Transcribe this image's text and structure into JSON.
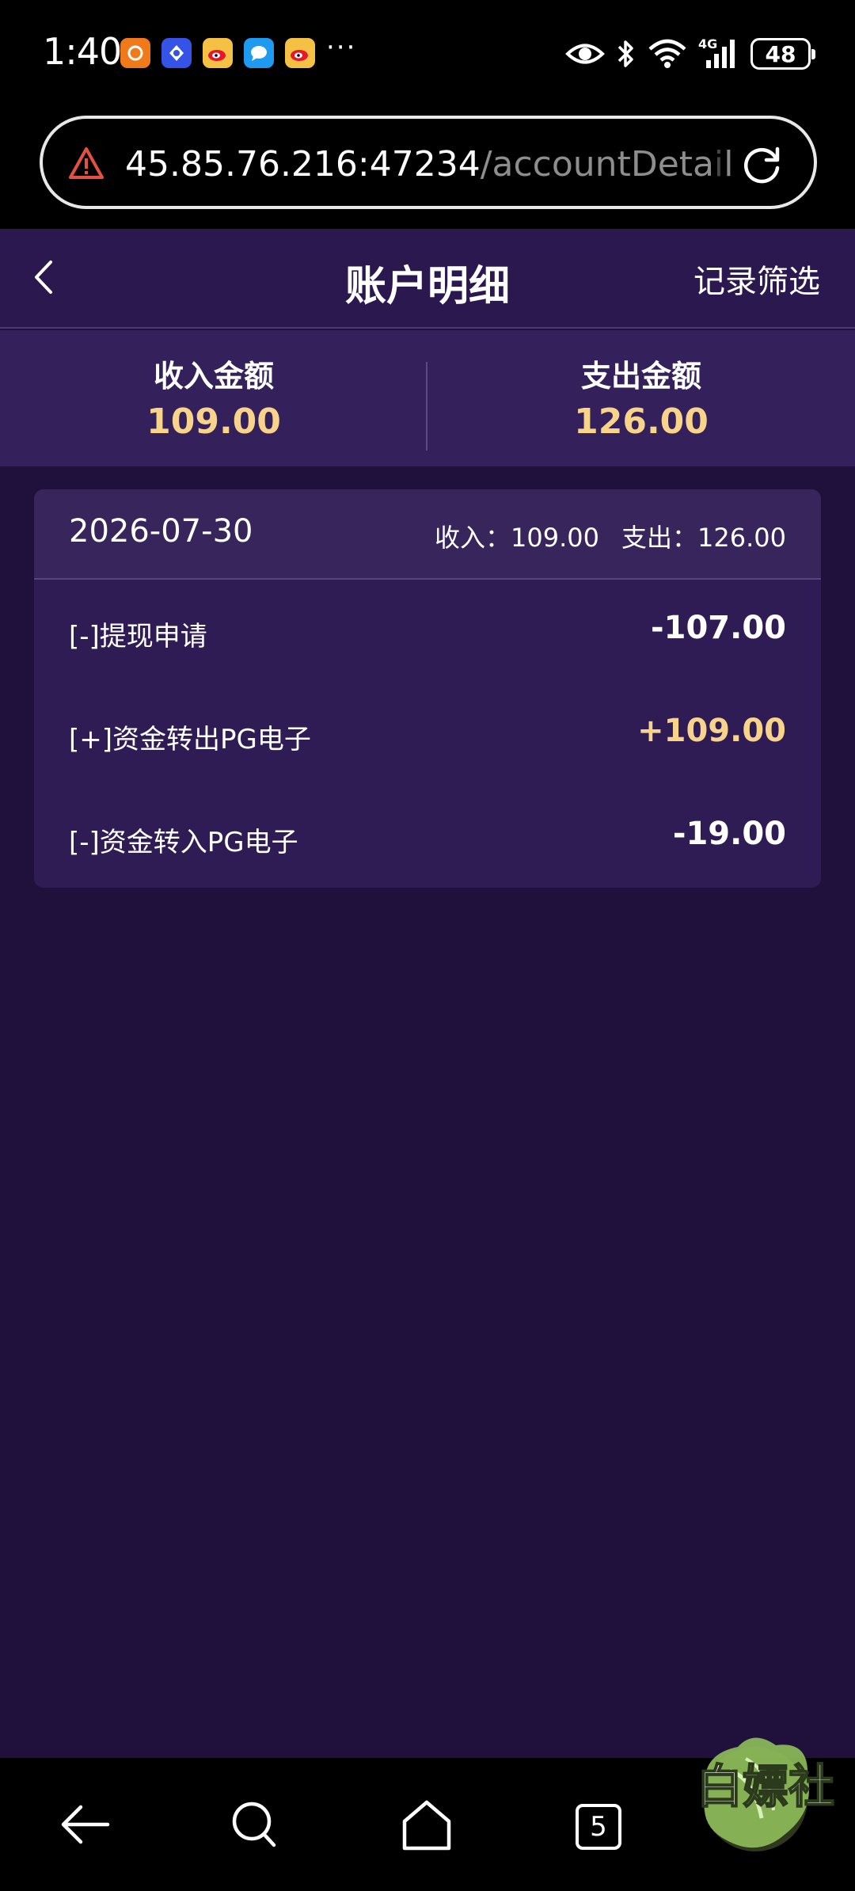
{
  "status_bar": {
    "time": "1:40",
    "notification_icons": [
      "app-icon-orange",
      "app-icon-blue",
      "weibo-icon",
      "message-icon",
      "weibo-icon"
    ],
    "more": "···",
    "right_icons": [
      "eye-icon",
      "bluetooth-icon",
      "wifi-icon",
      "signal-4g-icon"
    ],
    "network": "4G",
    "battery": "48"
  },
  "browser": {
    "url_host": "45.85.76.216:47234",
    "url_path": "/accountDetail"
  },
  "header": {
    "title": "账户明细",
    "filter_label": "记录筛选"
  },
  "summary": {
    "income_label": "收入金额",
    "income_value": "109.00",
    "expense_label": "支出金额",
    "expense_value": "126.00"
  },
  "records": {
    "date": "2026-07-30",
    "income_text": "收入：",
    "income_value": "109.00",
    "expense_text": "支出：",
    "expense_value": "126.00",
    "items": [
      {
        "desc": "[-]提现申请",
        "amount": "-107.00"
      },
      {
        "desc": "[+]资金转出PG电子",
        "amount": "+109.00"
      },
      {
        "desc": "[-]资金转入PG电子",
        "amount": "-19.00"
      }
    ]
  },
  "nav": {
    "tab_count": "5"
  },
  "watermark": {
    "text": "白嫖社"
  },
  "colors": {
    "background": "#20113c",
    "header": "#2b184f",
    "summary": "#34205a",
    "card": "#301c55",
    "accent_gold": "#f7d48a"
  }
}
